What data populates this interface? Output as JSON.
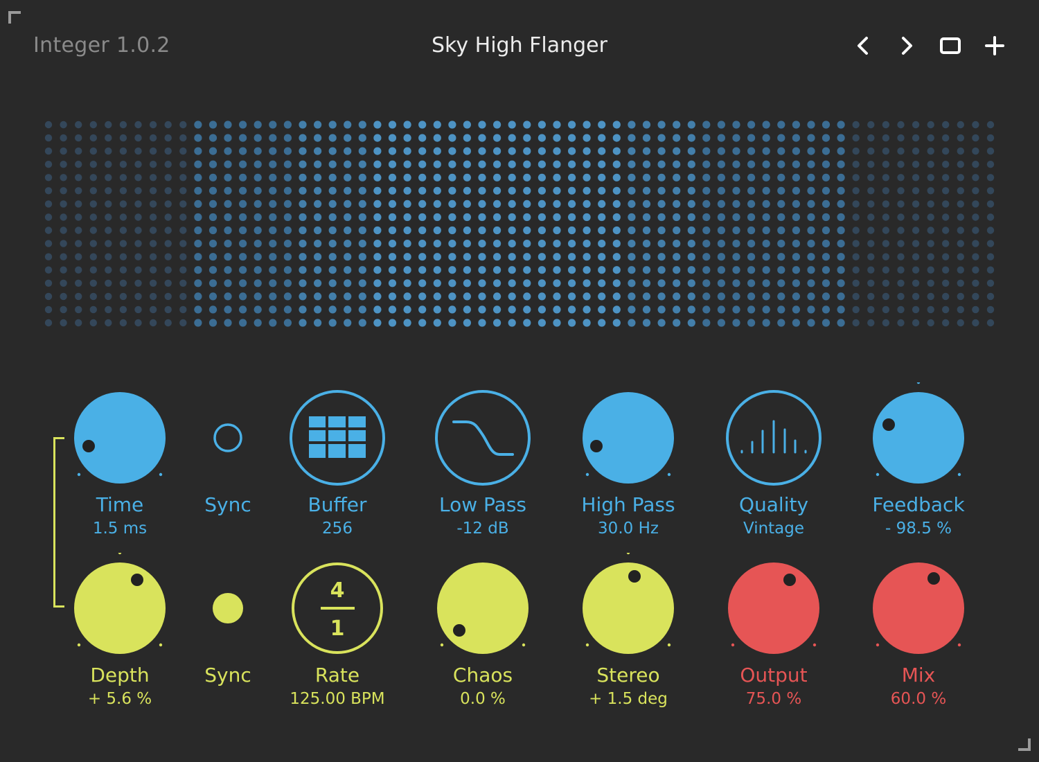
{
  "header": {
    "app_title": "Integer 1.0.2",
    "preset_name": "Sky High Flanger"
  },
  "toolbar": {
    "prev_icon": "chevron-left-icon",
    "next_icon": "chevron-right-icon",
    "window_icon": "window-icon",
    "add_icon": "plus-icon"
  },
  "colors": {
    "background": "#292929",
    "blue": "#4ab0e6",
    "yellow": "#d9e35c",
    "red": "#e65555"
  },
  "top_row": {
    "time": {
      "label": "Time",
      "value": "1.5 ms",
      "level": 0.02
    },
    "sync": {
      "label": "Sync",
      "state": "off"
    },
    "buffer": {
      "label": "Buffer",
      "value": "256",
      "icon": "grid-icon"
    },
    "low_pass": {
      "label": "Low Pass",
      "value": "-12 dB",
      "icon": "lowpass-curve-icon"
    },
    "high_pass": {
      "label": "High Pass",
      "value": "30.0 Hz",
      "level": 0.02
    },
    "quality": {
      "label": "Quality",
      "value": "Vintage",
      "icon": "spectrum-bars-icon"
    },
    "feedback": {
      "label": "Feedback",
      "value": "- 98.5 %",
      "level": 0.14
    }
  },
  "bottom_row": {
    "depth": {
      "label": "Depth",
      "value": "+ 5.6 %",
      "level": 0.72
    },
    "sync": {
      "label": "Sync",
      "state": "on"
    },
    "rate": {
      "label": "Rate",
      "value": "125.00 BPM",
      "numerator": "4",
      "denominator": "1"
    },
    "chaos": {
      "label": "Chaos",
      "value": "0.0 %",
      "level": 0.0
    },
    "stereo": {
      "label": "Stereo",
      "value": "+ 1.5 deg",
      "level": 0.52
    },
    "output": {
      "label": "Output",
      "value": "75.0 %",
      "level": 0.75
    },
    "mix": {
      "label": "Mix",
      "value": "60.0 %",
      "level": 0.75
    }
  }
}
